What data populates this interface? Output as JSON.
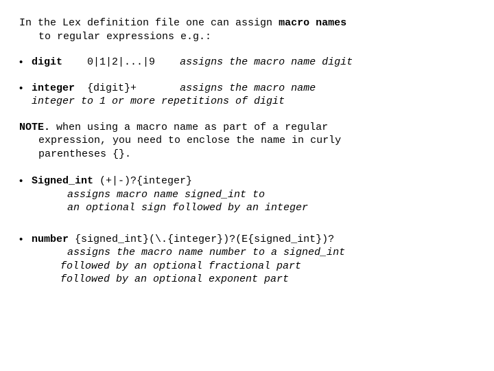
{
  "intro": {
    "line1_pre": "In the Lex definition file one can assign ",
    "line1_bold": "macro names",
    "line2": "to regular expressions e.g.:"
  },
  "bullets": {
    "digit": {
      "name": "digit",
      "pattern": "0|1|2|...|9",
      "desc": "assigns the macro name digit"
    },
    "integer": {
      "name": "integer",
      "pattern": "{digit}+",
      "desc_tail": "assigns the macro name",
      "line2_italic_pre": "integer ",
      "line2_italic_post": "to 1 or more repetitions of digit"
    },
    "signed": {
      "name": "Signed_int",
      "pattern": "(+|-)?{integer}",
      "l1": "assigns macro name signed_int to",
      "l2": "an optional sign followed by an integer"
    },
    "number": {
      "name": "number",
      "pattern": "{signed_int}(\\.{integer})?(E{signed_int})?",
      "l1": "assigns the macro name number to a signed_int",
      "l2": "followed by an optional fractional part",
      "l3": "followed by an optional exponent part"
    }
  },
  "note": {
    "label": "NOTE.",
    "line1": "when using a macro name as part of a regular",
    "line2": "expression, you need to enclose the name in curly",
    "line3": "parentheses {}."
  },
  "glyphs": {
    "bullet": "•"
  }
}
